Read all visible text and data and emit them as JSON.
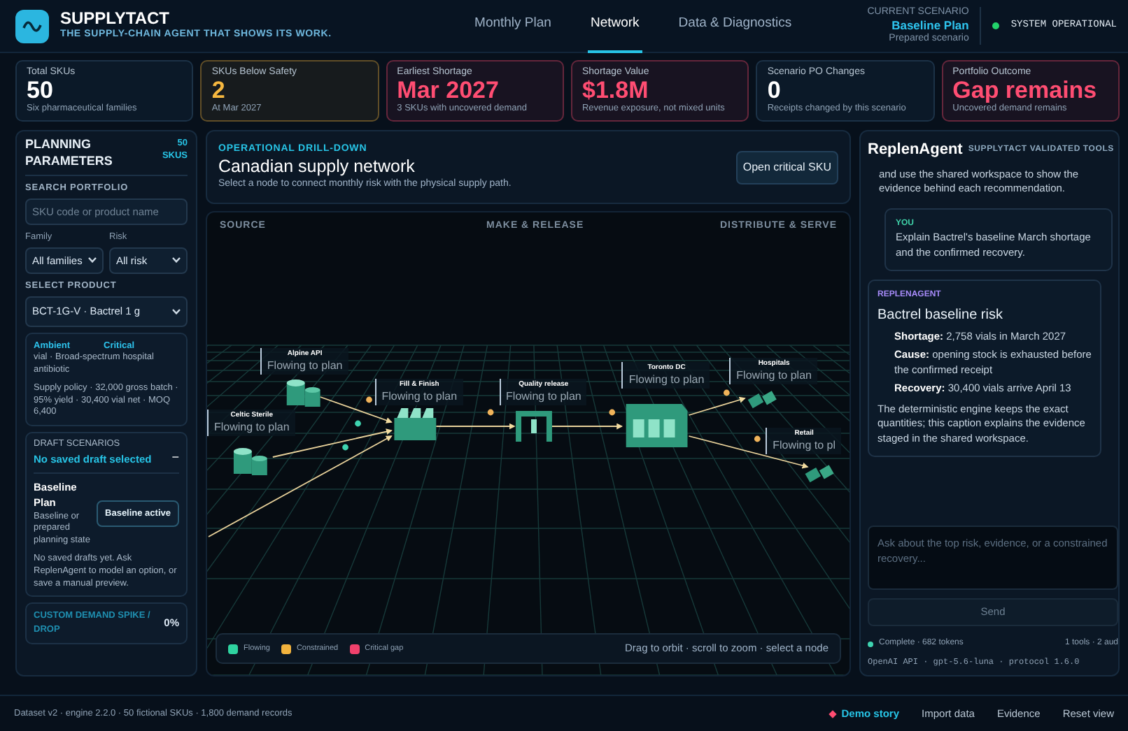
{
  "brand": {
    "name": "SUPPLYTACT",
    "tagline": "THE SUPPLY-CHAIN AGENT THAT SHOWS ITS WORK."
  },
  "nav_tabs": [
    {
      "label": "Monthly Plan",
      "selected": false
    },
    {
      "label": "Network",
      "selected": true
    },
    {
      "label": "Data & Diagnostics",
      "selected": false
    }
  ],
  "scenario": {
    "caption": "CURRENT SCENARIO",
    "name": "Baseline Plan",
    "note": "Prepared scenario"
  },
  "system_status": {
    "label": "SYSTEM OPERATIONAL",
    "ok": true
  },
  "kpis": [
    {
      "label": "Total SKUs",
      "value": "50",
      "note": "Six pharmaceutical families",
      "color": "#ffffff"
    },
    {
      "label": "SKUs Below Safety",
      "value": "2",
      "note": "At Mar 2027",
      "color": "#f5b73f"
    },
    {
      "label": "Earliest Shortage",
      "value": "Mar 2027",
      "note": "3 SKUs with uncovered demand",
      "color": "#ff4d72"
    },
    {
      "label": "Shortage Value",
      "value": "$1.8M",
      "note": "Revenue exposure, not mixed units",
      "color": "#ff4d72"
    },
    {
      "label": "Scenario PO Changes",
      "value": "0",
      "note": "Receipts changed by this scenario",
      "color": "#ffffff"
    },
    {
      "label": "Portfolio Outcome",
      "value": "Gap remains",
      "note": "Uncovered demand remains",
      "color": "#ff4d72"
    }
  ],
  "planning": {
    "title": "PLANNING PARAMETERS",
    "count": "50 SKUS",
    "search_label": "SEARCH PORTFOLIO",
    "search_placeholder": "SKU code or product name",
    "filters": [
      {
        "label": "Family",
        "value": "All families"
      },
      {
        "label": "Risk",
        "value": "All risk"
      }
    ],
    "product_label": "SELECT PRODUCT",
    "product": "BCT-1G-V · Bactrel 1 g",
    "product_info": {
      "storage": "Ambient",
      "criticality": "Critical",
      "description": "vial · Broad-spectrum hospital antibiotic",
      "policy": "Supply policy · 32,000 gross batch · 95% yield · 30,400 vial net · MOQ 6,400"
    },
    "drafts": {
      "caption": "DRAFT SCENARIOS",
      "status": "No saved draft selected",
      "toggle": "−",
      "plan_name": "Baseline Plan",
      "plan_note": "Baseline or prepared planning state",
      "plan_button": "Baseline active",
      "plan_active": true,
      "empty_note": "No saved drafts yet. Ask ReplenAgent to model an option, or save a manual preview."
    },
    "demand": {
      "label": "CUSTOM DEMAND SPIKE / DROP",
      "value": "0%"
    }
  },
  "drilldown": {
    "eyebrow": "OPERATIONAL DRILL-DOWN",
    "title": "Canadian supply network",
    "subtitle": "Select a node to connect monthly risk with the physical supply path.",
    "button": "Open critical SKU"
  },
  "network": {
    "stages": [
      "SOURCE",
      "MAKE & RELEASE",
      "DISTRIBUTE & SERVE"
    ],
    "nodes": [
      {
        "name": "Alpine API",
        "status_text": "Flowing to plan",
        "color": "#2f9a7c",
        "kind": "tanks"
      },
      {
        "name": "Celtic Sterile",
        "status_text": "Flowing to plan",
        "color": "#2f9a7c",
        "kind": "tanks"
      },
      {
        "name": "Fill & Finish",
        "status_text": "Flowing to plan",
        "color": "#2f9a7c",
        "kind": "factory"
      },
      {
        "name": "Quality release",
        "status_text": "Flowing to plan",
        "color": "#2f9a7c",
        "kind": "gate"
      },
      {
        "name": "Toronto DC",
        "status_text": "Flowing to plan",
        "color": "#2f9a7c",
        "kind": "warehouse"
      },
      {
        "name": "Hospitals",
        "status_text": "Flowing to plan",
        "color": "#2f9a7c",
        "kind": "crates"
      },
      {
        "name": "Retail",
        "status_text": "Flowing to pl",
        "color": "#2f9a7c",
        "kind": "crates"
      }
    ],
    "legend": [
      {
        "label": "Flowing",
        "color": "#2fd3a0"
      },
      {
        "label": "Constrained",
        "color": "#f2b33d"
      },
      {
        "label": "Critical gap",
        "color": "#f0416c"
      }
    ],
    "hint": "Drag to orbit · scroll to zoom · select a node"
  },
  "agent": {
    "name": "ReplenAgent",
    "subtitle": "SUPPLYTACT VALIDATED TOOLS",
    "messages": [
      {
        "kind": "intro",
        "text": "and use the shared workspace to show the evidence behind each recommendation."
      },
      {
        "kind": "user",
        "author": "YOU",
        "text": "Explain Bactrel's baseline March shortage and the confirmed recovery."
      },
      {
        "kind": "agent",
        "author": "REPLENAGENT",
        "title": "Bactrel baseline risk",
        "points": [
          "**Shortage:** 2,758 vials in March 2027",
          "**Cause:** opening stock is exhausted before the confirmed receipt",
          "**Recovery:** 30,400 vials arrive April 13"
        ],
        "text": "The deterministic engine keeps the exact quantities; this caption explains the evidence staged in the shared workspace."
      }
    ],
    "input_placeholder": "Ask about the top risk, evidence, or a constrained recovery...",
    "send": "Send",
    "send_disabled": true,
    "status": "Complete · 682 tokens",
    "tools": "1 tools · 2 aud",
    "model": "OpenAI API · gpt-5.6-luna · protocol 1.6.0"
  },
  "footer": {
    "info": "Dataset v2 · engine 2.2.0 · 50 fictional SKUs · 1,800 demand records",
    "links": [
      {
        "label": "Demo story",
        "highlighted": true
      },
      {
        "label": "Import data",
        "highlighted": false
      },
      {
        "label": "Evidence",
        "highlighted": false
      },
      {
        "label": "Reset view",
        "highlighted": false
      }
    ]
  }
}
